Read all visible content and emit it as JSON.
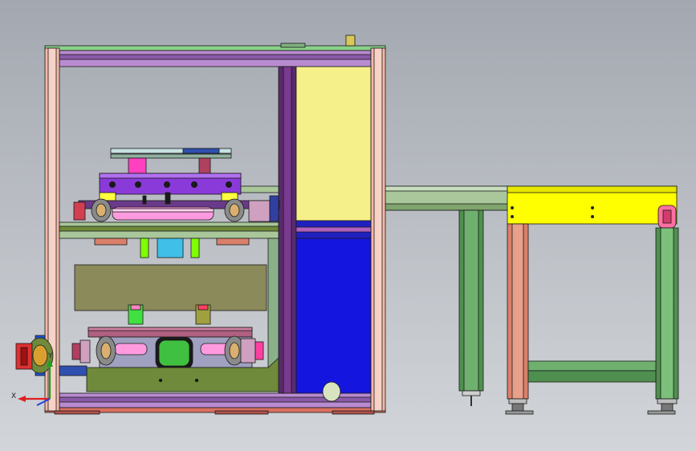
{
  "view": {
    "background": [
      "#a3a8b0",
      "#d2d5d9"
    ],
    "palette": {
      "frame_post": "#f2b9a8",
      "frame_beam": "#b98bd0",
      "purple_column": "#5a2a6e",
      "cabinet_upper": "#f6f08a",
      "cabinet_lower": "#1515e0",
      "conveyor_yellow": "#ffff00",
      "leg_green": "#5aa35a",
      "leg_salmon": "#d9806a",
      "plate_olive": "#6e8a3a",
      "panel_khaki": "#8a8a5a",
      "roller_pink": "#ff9adf",
      "block_purple": "#8a3ad9"
    }
  },
  "triad": {
    "x_label": "X",
    "y_label": "Y",
    "x_color": "#e02020",
    "y_color": "#20a020",
    "z_color": "#2040e0"
  }
}
